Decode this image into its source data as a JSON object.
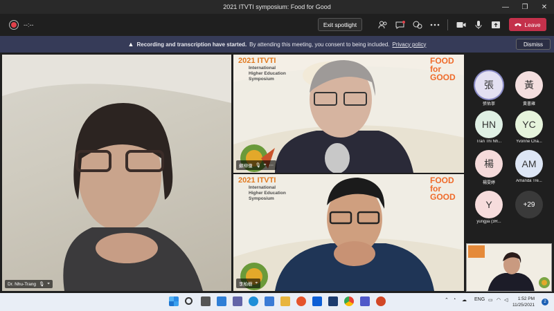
{
  "window": {
    "title": "2021 ITVTI symposium: Food for Good",
    "minimize": "—",
    "restore": "❐",
    "close": "✕"
  },
  "toolbar": {
    "timer": "--:--",
    "exit_spotlight": "Exit spotlight",
    "leave": "Leave",
    "icons": [
      "participants-icon",
      "chat-icon",
      "reactions-icon",
      "more-icon",
      "camera-icon",
      "mic-icon",
      "share-icon"
    ]
  },
  "banner": {
    "bold": "Recording and transcription have started.",
    "text": "By attending this meeting, you consent to being included.",
    "link": "Privacy policy",
    "dismiss": "Dismiss"
  },
  "slide": {
    "title": "2021 ITVTI",
    "subtitle_lines": [
      "International",
      "Higher Education",
      "Symposium"
    ],
    "food_lines": [
      "FOOD",
      "for",
      "GOOD"
    ]
  },
  "tiles": [
    {
      "name": "Dr. Nhu-Trang"
    },
    {
      "name": "蘇柳億"
    },
    {
      "name": "李柏樹"
    }
  ],
  "roster": [
    {
      "initials": "張",
      "name": "張佑寧",
      "bg": "#e3e0f2"
    },
    {
      "initials": "黃",
      "name": "黃書雍",
      "bg": "#f3dede"
    },
    {
      "initials": "HN",
      "name": "Tran Thi Nh...",
      "bg": "#dff0e4"
    },
    {
      "initials": "YC",
      "name": "Yvonne Cha...",
      "bg": "#e6f4dc"
    },
    {
      "initials": "楊",
      "name": "楊雯婷",
      "bg": "#f5dada"
    },
    {
      "initials": "AM",
      "name": "Amanda Tre...",
      "bg": "#dde6f5"
    },
    {
      "initials": "Y",
      "name": "yungjia (3R...",
      "bg": "#f6dcdc"
    },
    {
      "initials": "+29",
      "name": "",
      "bg": "#3a3a3a"
    }
  ],
  "taskbar": {
    "lang": "ENG",
    "time": "1:52 PM",
    "date": "11/25/2021",
    "notif": "2"
  }
}
